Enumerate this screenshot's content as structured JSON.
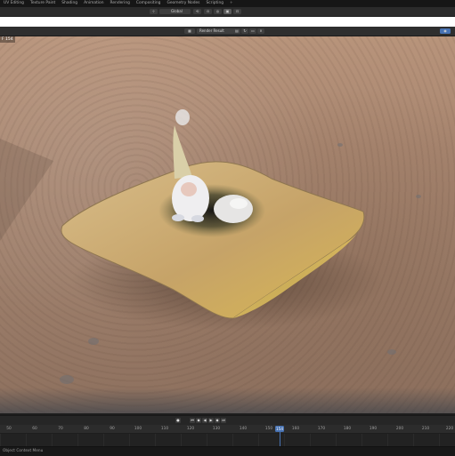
{
  "workspace_tabs": [
    "UV Editing",
    "Texture Paint",
    "Shading",
    "Animation",
    "Rendering",
    "Compositing",
    "Geometry Nodes",
    "Scripting",
    "+"
  ],
  "header": {
    "transform_orientation": "Global"
  },
  "image_editor": {
    "image_name": "Render Result"
  },
  "viewport": {
    "frame_label": "F 154"
  },
  "timeline": {
    "ticks": [
      "50",
      "60",
      "70",
      "80",
      "90",
      "100",
      "110",
      "120",
      "130",
      "140",
      "150",
      "160",
      "170",
      "180",
      "190",
      "200",
      "210",
      "220"
    ],
    "current_frame": "154"
  },
  "status_bar": {
    "text": "Object Context Menu"
  },
  "colors": {
    "accent": "#4772b3",
    "viewport_sand": "#a88670",
    "pillow": "#c9a56a"
  },
  "icons": [
    "editor-type-icon",
    "image-browse-icon",
    "camera-icon",
    "play-icon",
    "jump-start-icon",
    "jump-end-icon",
    "keyframe-icon"
  ]
}
